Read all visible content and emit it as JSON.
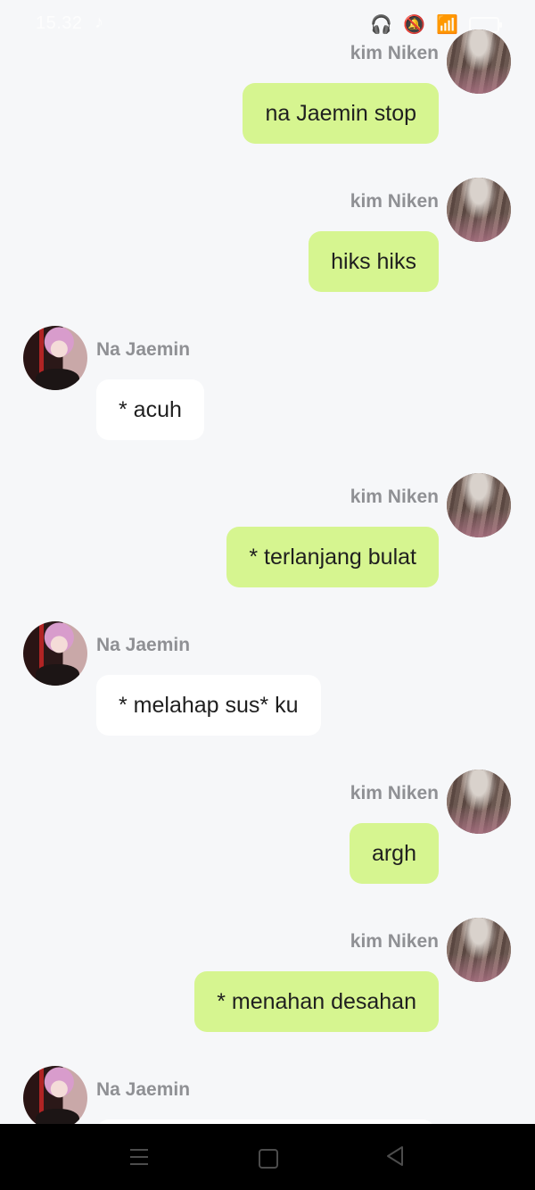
{
  "status_bar": {
    "time": "15.32"
  },
  "messages": [
    {
      "sender": "kim Niken",
      "side": "right",
      "text": "na Jaemin stop"
    },
    {
      "sender": "kim Niken",
      "side": "right",
      "text": "hiks hiks"
    },
    {
      "sender": "Na Jaemin",
      "side": "left",
      "text": "* acuh"
    },
    {
      "sender": "kim Niken",
      "side": "right",
      "text": "* terlanjang bulat"
    },
    {
      "sender": "Na Jaemin",
      "side": "left",
      "text": "* melahap sus* ku"
    },
    {
      "sender": "kim Niken",
      "side": "right",
      "text": "argh"
    },
    {
      "sender": "kim Niken",
      "side": "right",
      "text": "* menahan desahan"
    },
    {
      "sender": "Na Jaemin",
      "side": "left",
      "text": ""
    }
  ],
  "colors": {
    "background": "#f6f7f9",
    "sent_bubble": "#d6f590",
    "received_bubble": "#ffffff",
    "name_text": "#8f9094"
  },
  "icons": {
    "status": [
      "music-note-icon",
      "headphones-icon",
      "mute-icon",
      "wifi-icon",
      "battery-icon"
    ],
    "navigation": [
      "menu-icon",
      "home-icon",
      "back-icon"
    ]
  }
}
